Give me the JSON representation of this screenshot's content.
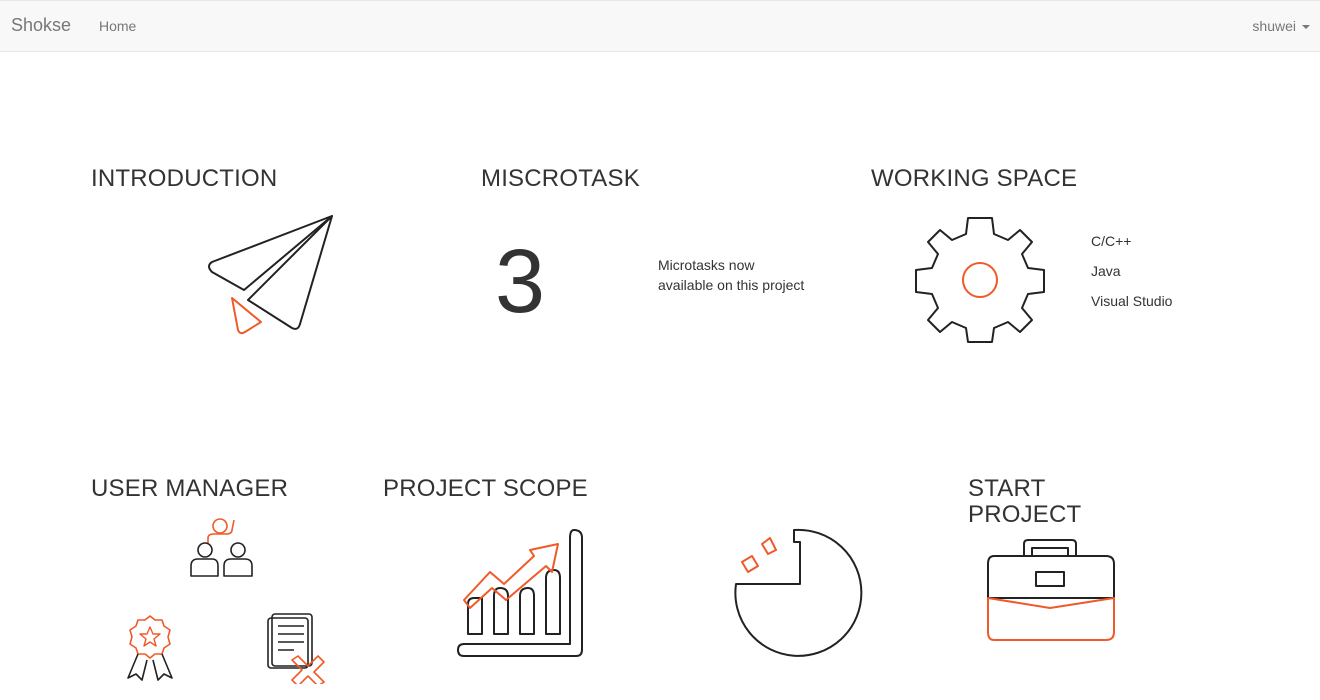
{
  "navbar": {
    "brand": "Shokse",
    "home_label": "Home",
    "user_label": "shuwei"
  },
  "sections": {
    "introduction": {
      "title": "INTRODUCTION"
    },
    "microtask": {
      "title": "MISCROTASK",
      "count": "3",
      "line1": "Microtasks now",
      "line2": "available on this project"
    },
    "working_space": {
      "title": "WORKING SPACE",
      "items": [
        "C/C++",
        "Java",
        "Visual Studio"
      ]
    },
    "user_manager": {
      "title": "USER MANAGER"
    },
    "project_scope": {
      "title": "PROJECT SCOPE"
    },
    "start_project": {
      "title_line1": "START",
      "title_line2": "PROJECT"
    }
  },
  "icons": {
    "paper_plane": "paper-plane-icon",
    "gear": "gear-icon",
    "users": "users-icon",
    "award": "award-ribbon-icon",
    "document_reject": "document-reject-icon",
    "growth_chart": "growth-chart-icon",
    "pie_chart": "pie-chart-icon",
    "briefcase": "briefcase-icon"
  },
  "colors": {
    "accent": "#f05a28",
    "stroke": "#222222",
    "navbar_bg": "#f8f8f8",
    "nav_text": "#777777"
  }
}
